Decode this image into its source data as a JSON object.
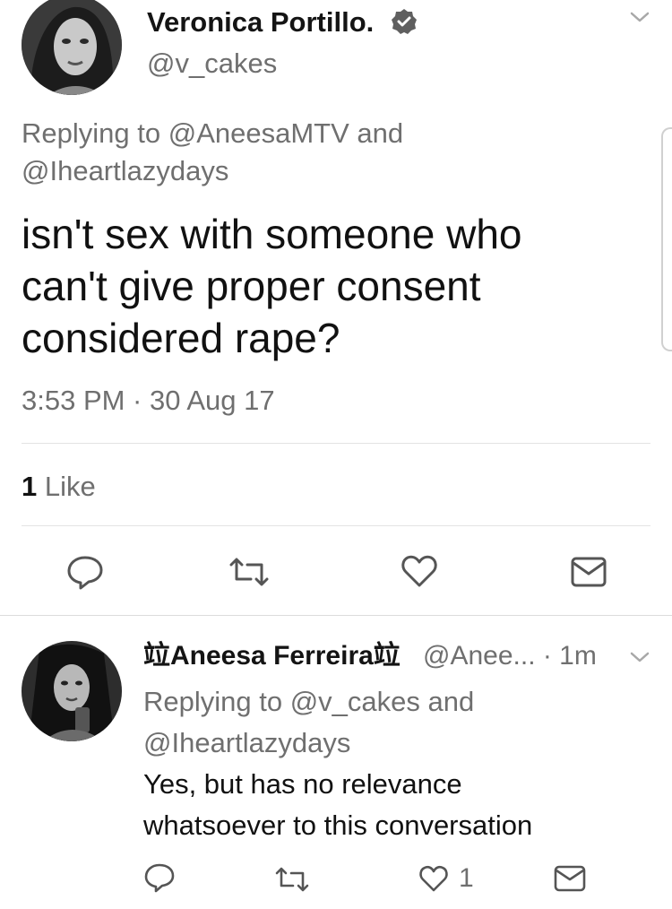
{
  "tweet": {
    "author_name": "Veronica Portillo.",
    "handle": "@v_cakes",
    "replying_prefix": "Replying to",
    "replying_to_1": "@AneesaMTV",
    "replying_and": "and",
    "replying_to_2": "@Iheartlazydays",
    "text_line1": "isn't sex with someone who",
    "text_line2": "can't give proper consent",
    "text_line3": "considered rape?",
    "timestamp": "3:53 PM · 30 Aug 17",
    "likes_count": "1",
    "likes_label": "Like",
    "icons": [
      "verified-badge-icon",
      "chevron-down-icon",
      "reply-icon",
      "retweet-icon",
      "like-icon",
      "message-icon"
    ]
  },
  "reply": {
    "author_name": "竝Aneesa Ferreira竝",
    "handle_time": "@Anee... · 1m",
    "replying_line1": "Replying to @v_cakes and",
    "replying_line2": "@Iheartlazydays",
    "text_line1": "Yes, but has no relevance",
    "text_line2": "whatsoever to this conversation",
    "like_count": "1",
    "icons": [
      "chevron-down-icon",
      "reply-icon",
      "retweet-icon",
      "like-icon",
      "message-icon"
    ]
  }
}
